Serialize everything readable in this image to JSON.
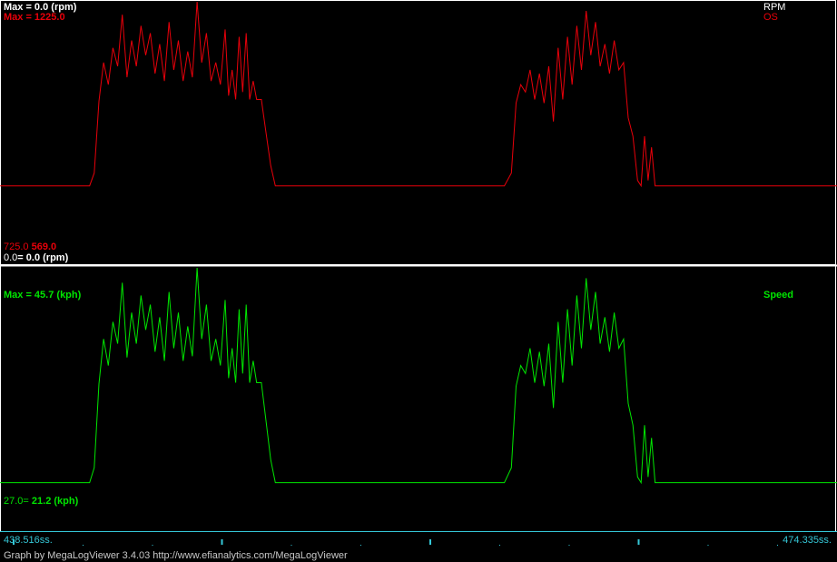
{
  "app": {
    "credit": "Graph by MegaLogViewer 3.4.03 http://www.efianalytics.com/MegaLogViewer"
  },
  "colors": {
    "background": "#000000",
    "frame": "#ffffff",
    "rpm": "#ffffff",
    "os": "#e8000a",
    "speed": "#00e600",
    "time_axis": "#35c8d8"
  },
  "panels": {
    "top": {
      "max_rpm_label": "Max = 0.0 (rpm)",
      "max_os_label": "Max = 1225.0",
      "legend_rpm": "RPM",
      "legend_os": "OS",
      "min_os_prefix": "725.0",
      "min_os_value": "569.0",
      "min_rpm_prefix": "0.0",
      "min_rpm_value": "= 0.0 (rpm)"
    },
    "bottom": {
      "max_speed_label": "Max = 45.7 (kph)",
      "legend_speed": "Speed",
      "min_speed_prefix": "27.0=",
      "min_speed_value": "21.2 (kph)"
    }
  },
  "time_axis": {
    "start_label": "438.516ss.",
    "end_label": "474.335ss."
  },
  "chart_data": [
    {
      "type": "line",
      "title": "",
      "x_range": [
        438.516,
        474.335
      ],
      "ylim": [
        569.0,
        1225.0
      ],
      "series": [
        {
          "name": "OS",
          "x": [
            438.52,
            442.35,
            442.55,
            442.75,
            442.95,
            443.15,
            443.35,
            443.55,
            443.75,
            443.95,
            444.15,
            444.35,
            444.55,
            444.75,
            444.95,
            445.15,
            445.35,
            445.55,
            445.75,
            445.95,
            446.15,
            446.35,
            446.55,
            446.75,
            446.95,
            447.15,
            447.35,
            447.55,
            447.75,
            447.95,
            448.15,
            448.3,
            448.45,
            448.6,
            448.75,
            448.9,
            449.05,
            449.2,
            449.35,
            449.5,
            449.7,
            449.9,
            450.1,
            450.3,
            450.45,
            450.6,
            460.1,
            460.4,
            460.6,
            460.8,
            461.0,
            461.2,
            461.4,
            461.6,
            461.8,
            462.0,
            462.2,
            462.4,
            462.6,
            462.8,
            463.0,
            463.2,
            463.4,
            463.6,
            463.8,
            464.0,
            464.2,
            464.4,
            464.6,
            464.8,
            465.0,
            465.2,
            465.4,
            465.6,
            465.8,
            465.95,
            466.1,
            466.25,
            466.4,
            466.55,
            466.7,
            466.85,
            474.34
          ],
          "values": [
            725,
            725,
            760,
            955,
            1060,
            1000,
            1100,
            1050,
            1190,
            1020,
            1120,
            1050,
            1160,
            1080,
            1140,
            1030,
            1110,
            1010,
            1170,
            1040,
            1120,
            1010,
            1090,
            1020,
            1225,
            1060,
            1140,
            1010,
            1060,
            1000,
            1150,
            970,
            1040,
            960,
            1130,
            980,
            1140,
            960,
            1010,
            960,
            960,
            870,
            780,
            725,
            725,
            725,
            725,
            760,
            950,
            1000,
            980,
            1040,
            960,
            1030,
            950,
            1050,
            900,
            1100,
            960,
            1130,
            1000,
            1160,
            1040,
            1200,
            1080,
            1170,
            1050,
            1110,
            1030,
            1120,
            1040,
            1060,
            910,
            860,
            740,
            725,
            860,
            740,
            830,
            725,
            725,
            725,
            725
          ]
        }
      ]
    },
    {
      "type": "line",
      "title": "",
      "x_range": [
        438.516,
        474.335
      ],
      "ylim": [
        21.2,
        45.7
      ],
      "series": [
        {
          "name": "Speed",
          "x": [
            438.52,
            442.35,
            442.55,
            442.75,
            442.95,
            443.15,
            443.35,
            443.55,
            443.75,
            443.95,
            444.15,
            444.35,
            444.55,
            444.75,
            444.95,
            445.15,
            445.35,
            445.55,
            445.75,
            445.95,
            446.15,
            446.35,
            446.55,
            446.75,
            446.95,
            447.15,
            447.35,
            447.55,
            447.75,
            447.95,
            448.15,
            448.3,
            448.45,
            448.6,
            448.75,
            448.9,
            449.05,
            449.2,
            449.35,
            449.5,
            449.7,
            449.9,
            450.1,
            450.3,
            450.45,
            450.6,
            460.1,
            460.4,
            460.6,
            460.8,
            461.0,
            461.2,
            461.4,
            461.6,
            461.8,
            462.0,
            462.2,
            462.4,
            462.6,
            462.8,
            463.0,
            463.2,
            463.4,
            463.6,
            463.8,
            464.0,
            464.2,
            464.4,
            464.6,
            464.8,
            465.0,
            465.2,
            465.4,
            465.6,
            465.8,
            465.95,
            466.1,
            466.25,
            466.4,
            466.55,
            466.7,
            466.85,
            474.34
          ],
          "values": [
            27.0,
            27.0,
            28.3,
            35.6,
            39.5,
            37.2,
            41.0,
            39.1,
            44.4,
            37.9,
            41.8,
            39.1,
            43.3,
            40.3,
            42.5,
            38.4,
            41.4,
            37.6,
            43.6,
            38.7,
            41.8,
            37.6,
            40.6,
            38.0,
            45.7,
            39.5,
            42.5,
            37.6,
            39.5,
            37.2,
            42.9,
            36.1,
            38.7,
            35.7,
            42.1,
            36.5,
            42.5,
            35.7,
            37.6,
            35.7,
            35.7,
            32.4,
            29.0,
            27.0,
            27.0,
            27.0,
            27.0,
            28.3,
            35.4,
            37.2,
            36.5,
            38.7,
            35.7,
            38.4,
            35.4,
            39.1,
            33.5,
            41.0,
            35.7,
            42.1,
            37.2,
            43.3,
            38.7,
            44.8,
            40.3,
            43.6,
            39.1,
            41.4,
            38.4,
            41.8,
            38.7,
            39.5,
            33.9,
            32.0,
            27.5,
            27.0,
            32.0,
            27.5,
            30.9,
            27.0,
            27.0,
            27.0,
            27.0
          ]
        }
      ]
    }
  ]
}
